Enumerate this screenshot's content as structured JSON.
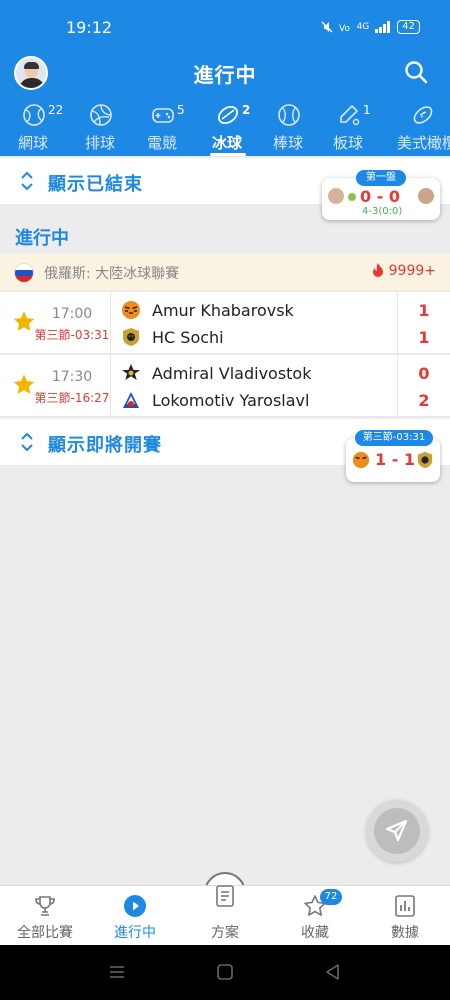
{
  "status_bar": {
    "time": "19:12",
    "signal_text": "⁺⁴ᴳ",
    "battery": "42"
  },
  "header": {
    "title": "進行中"
  },
  "sport_tabs": [
    {
      "label": "網球",
      "count": "22",
      "icon": "tennis-icon"
    },
    {
      "label": "排球",
      "count": "",
      "icon": "volleyball-icon"
    },
    {
      "label": "電競",
      "count": "5",
      "icon": "gamepad-icon"
    },
    {
      "label": "冰球",
      "count": "2",
      "icon": "hockey-puck-icon",
      "active": true
    },
    {
      "label": "棒球",
      "count": "",
      "icon": "baseball-icon"
    },
    {
      "label": "板球",
      "count": "1",
      "icon": "cricket-icon"
    },
    {
      "label": "美式橄欖",
      "count": "",
      "icon": "football-icon"
    }
  ],
  "finished": {
    "label": "顯示已結束",
    "card": {
      "badge": "第一盤",
      "score": "0 - 0",
      "sub": "4-3(0:0)"
    }
  },
  "live_section": {
    "title": "進行中"
  },
  "league": {
    "name": "俄羅斯: 大陸冰球聯賽",
    "count": "9999+",
    "flag_colors": [
      "#ffffff",
      "#1e50c8",
      "#d52b1e"
    ]
  },
  "matches": [
    {
      "time": "17:00",
      "period": "第三節-03:31",
      "home": {
        "name": "Amur Khabarovsk",
        "score": "1"
      },
      "away": {
        "name": "HC Sochi",
        "score": "1"
      }
    },
    {
      "time": "17:30",
      "period": "第三節-16:27",
      "home": {
        "name": "Admiral Vladivostok",
        "score": "0"
      },
      "away": {
        "name": "Lokomotiv Yaroslavl",
        "score": "2"
      }
    }
  ],
  "upcoming": {
    "label": "顯示即將開賽",
    "card": {
      "badge": "第三節-03:31",
      "score": "1 - 1"
    }
  },
  "bottom_nav": [
    {
      "label": "全部比賽",
      "icon": "trophy-icon"
    },
    {
      "label": "進行中",
      "icon": "play-icon",
      "active": true
    },
    {
      "label": "方案",
      "icon": "document-icon"
    },
    {
      "label": "收藏",
      "icon": "star-icon",
      "badge": "72"
    },
    {
      "label": "數據",
      "icon": "bar-chart-icon"
    }
  ],
  "colors": {
    "primary": "#1e88e5",
    "live_red": "#e53935",
    "star": "#f4b400",
    "league_bg": "#faf3e2"
  }
}
